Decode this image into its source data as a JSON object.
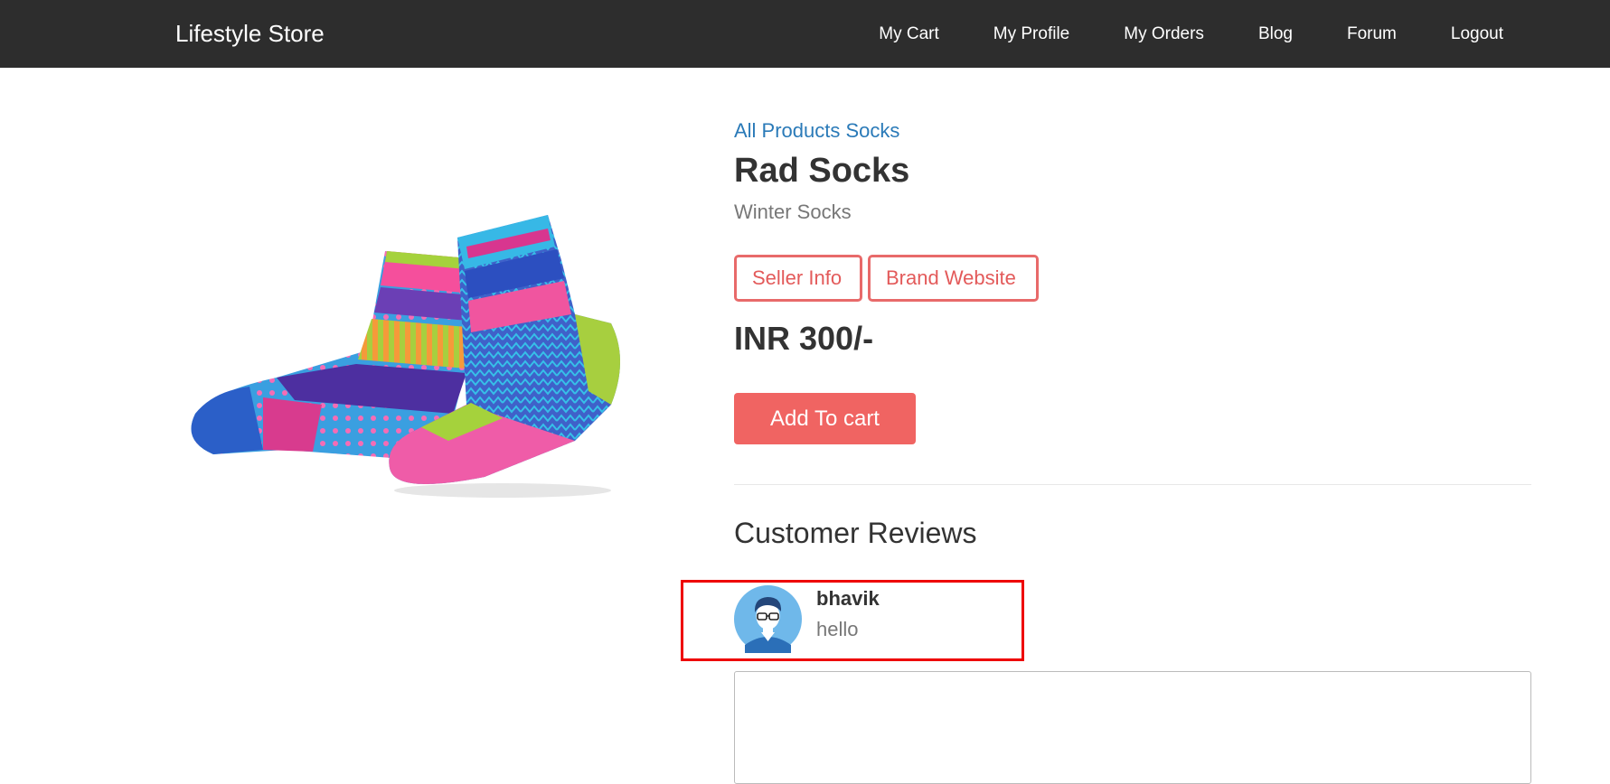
{
  "navbar": {
    "brand": "Lifestyle Store",
    "links": [
      "My Cart",
      "My Profile",
      "My Orders",
      "Blog",
      "Forum",
      "Logout"
    ]
  },
  "product": {
    "image_icon": "socks-image",
    "breadcrumb": "All Products Socks",
    "title": "Rad Socks",
    "subtitle": "Winter Socks",
    "seller_info_label": "Seller Info",
    "brand_website_label": "Brand Website",
    "price": "INR 300/-",
    "add_to_cart_label": "Add To cart"
  },
  "reviews": {
    "heading": "Customer Reviews",
    "items": [
      {
        "author": "bhavik",
        "text": "hello",
        "avatar_icon": "user-avatar-icon"
      }
    ],
    "input_value": ""
  },
  "colors": {
    "navbar_bg": "#2d2d2d",
    "accent": "#f06462",
    "link": "#2a7ab8",
    "highlight": "#ee0000"
  }
}
